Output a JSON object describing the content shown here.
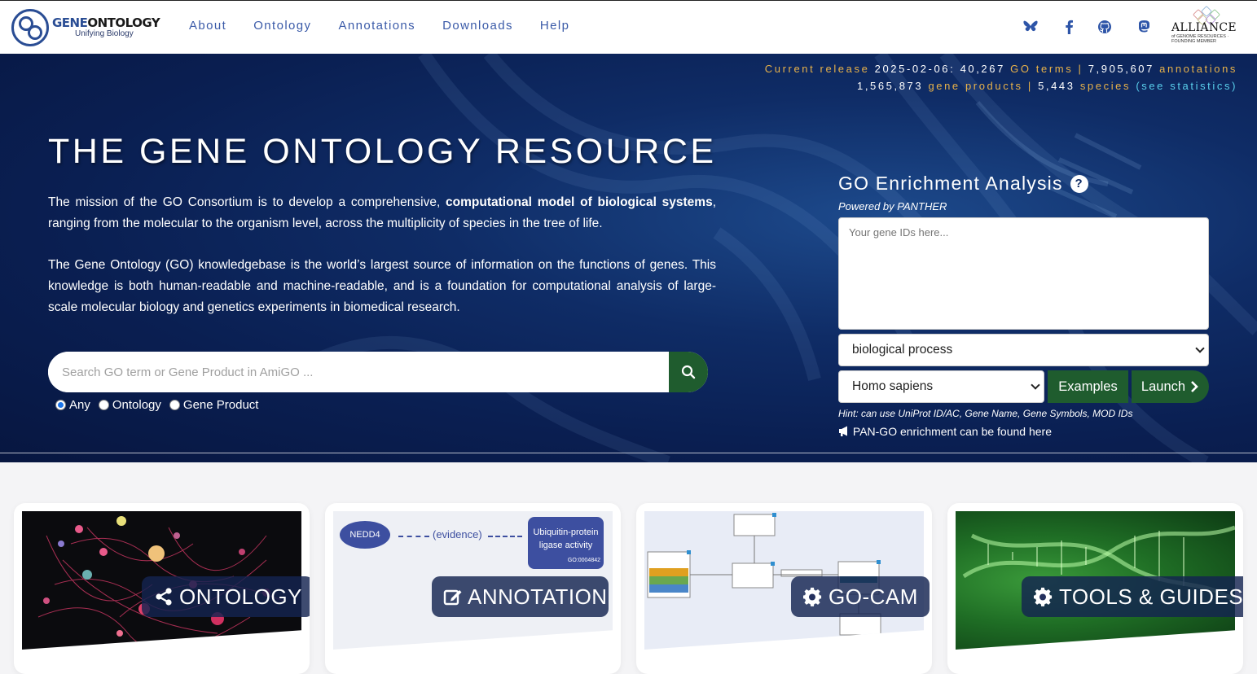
{
  "nav": {
    "logo_title_a": "GENE",
    "logo_title_b": "ONTOLOGY",
    "logo_subtitle": "Unifying Biology",
    "links": [
      "About",
      "Ontology",
      "Annotations",
      "Downloads",
      "Help"
    ],
    "social_icons": [
      "bluesky-icon",
      "facebook-icon",
      "github-icon",
      "mastodon-icon"
    ],
    "alliance_word": "ALLIANCE",
    "alliance_sub": "of GENOME RESOURCES · FOUNDING MEMBER"
  },
  "stats": {
    "release_label": "Current release",
    "release_date": "2025-02-06:",
    "go_terms_count": "40,267",
    "go_terms_label": "GO terms",
    "annotations_count": "7,905,607",
    "annotations_label": "annotations",
    "gene_products_count": "1,565,873",
    "gene_products_label": "gene products",
    "species_count": "5,443",
    "species_label": "species",
    "see_statistics": "(see statistics)",
    "separator": "|"
  },
  "hero": {
    "title": "THE GENE ONTOLOGY RESOURCE",
    "mission_p1_a": "The mission of the GO Consortium is to develop a comprehensive, ",
    "mission_p1_bold": "computational model of biological systems",
    "mission_p1_b": ", ranging from the molecular to the organism level, across the multiplicity of species in the tree of life.",
    "mission_p2": "The Gene Ontology (GO) knowledgebase is the world’s largest source of information on the functions of genes. This knowledge is both human-readable and machine-readable, and is a foundation for computational analysis of large-scale molecular biology and genetics experiments in biomedical research.",
    "search_placeholder": "Search GO term or Gene Product in AmiGO ...",
    "radio_options": [
      "Any",
      "Ontology",
      "Gene Product"
    ],
    "radio_selected": "Any"
  },
  "enrichment": {
    "title": "GO Enrichment Analysis",
    "help": "?",
    "powered_by": "Powered by PANTHER",
    "gene_placeholder": "Your gene IDs here...",
    "ontology_selected": "biological process",
    "species_selected": "Homo sapiens",
    "examples_label": "Examples",
    "launch_label": "Launch",
    "hint": "Hint: can use UniProt ID/AC, Gene Name, Gene Symbols, MOD IDs",
    "pango_text": "PAN-GO enrichment can be found here"
  },
  "cards": {
    "ontology": "ONTOLOGY",
    "annotation": "ANNOTATION",
    "gocam": "GO-CAM",
    "tools": "TOOLS & GUIDES"
  },
  "annotation_preview": {
    "gene": "NEDD4",
    "evidence": "(evidence)",
    "term": "Ubiquitin-protein ligase activity",
    "term_id": "GO:0004842"
  },
  "colors": {
    "navy": "#0a1f52",
    "nav_link": "#3a5aa8",
    "gold": "#e8b24a",
    "cyan": "#5ad0ec",
    "green_button": "#1f5c2e"
  }
}
